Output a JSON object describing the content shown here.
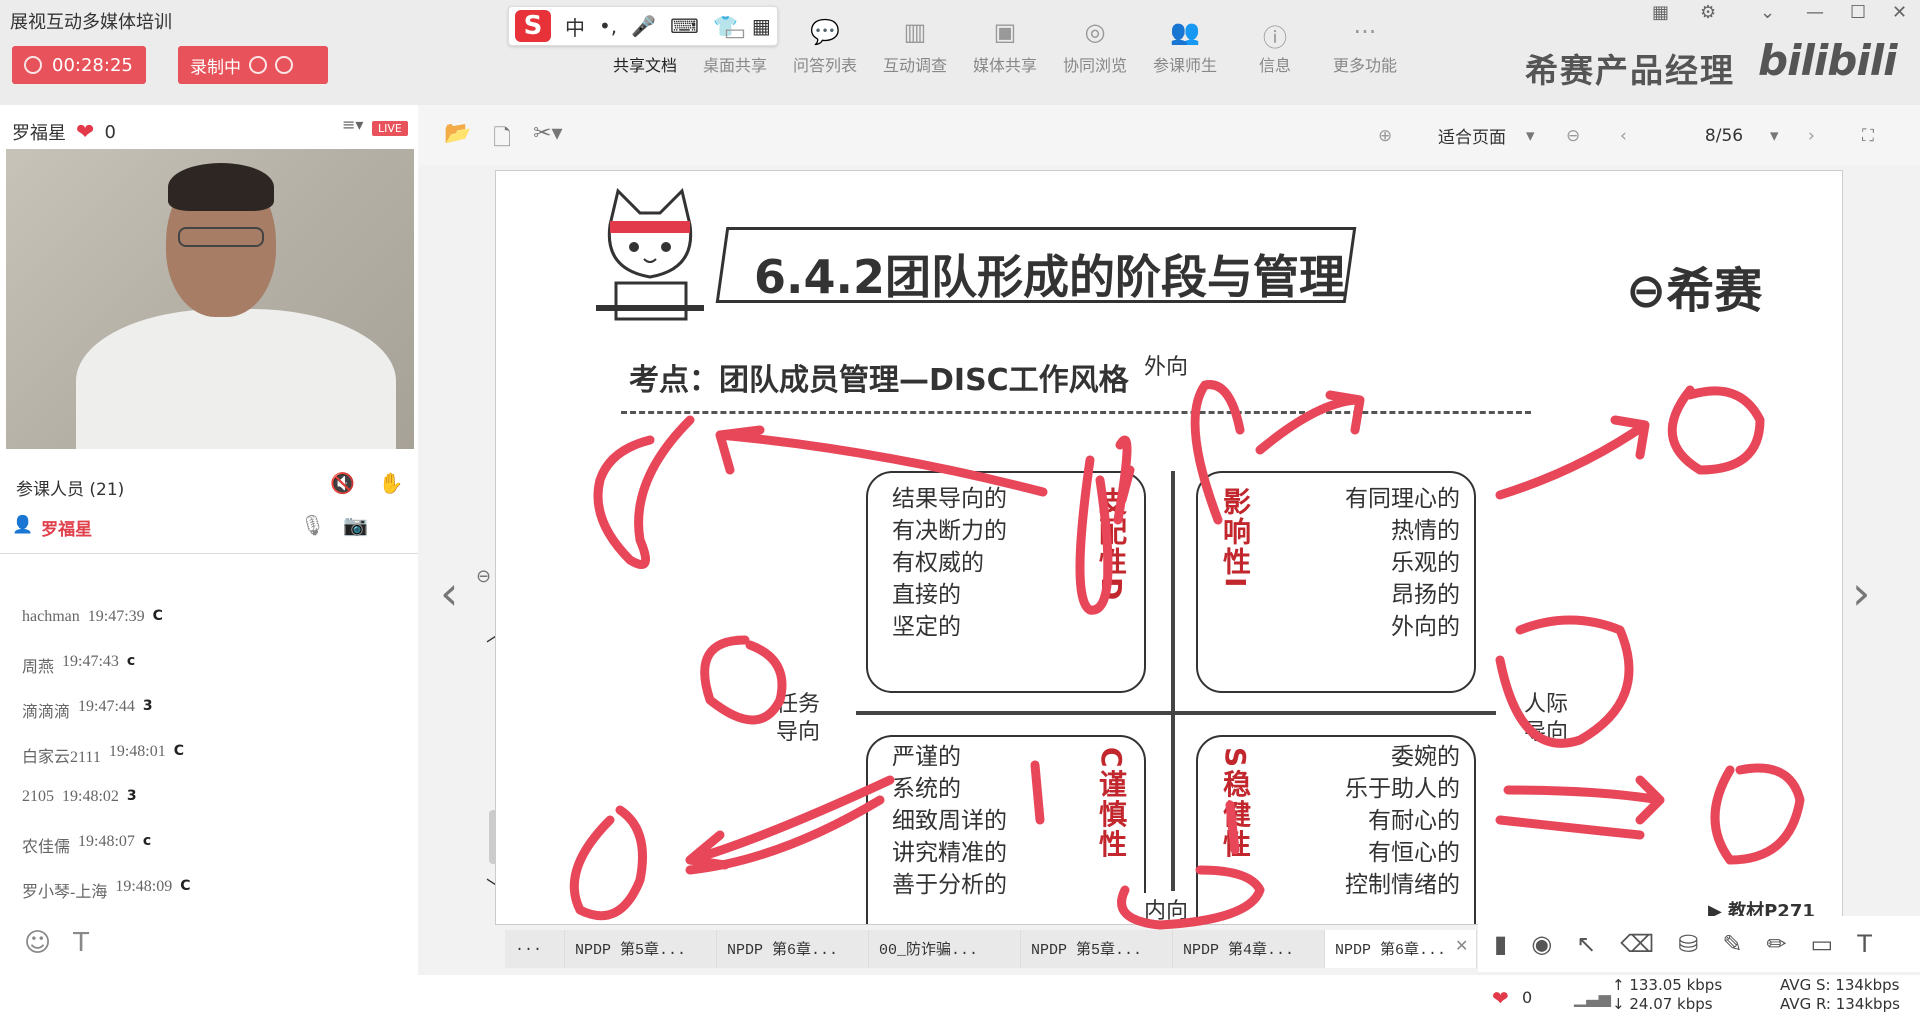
{
  "app": {
    "title": "展视互动多媒体培训"
  },
  "recording": {
    "elapsed": "00:28:25",
    "status": "录制中"
  },
  "ime": {
    "mode": "中",
    "punct": "•,"
  },
  "toolbar": {
    "tools": [
      {
        "label": "共享文档",
        "icon": "document-share-icon"
      },
      {
        "label": "桌面共享",
        "icon": "desktop-share-icon"
      },
      {
        "label": "问答列表",
        "icon": "qa-list-icon"
      },
      {
        "label": "互动调查",
        "icon": "survey-icon"
      },
      {
        "label": "媒体共享",
        "icon": "media-share-icon"
      },
      {
        "label": "协同浏览",
        "icon": "co-browse-icon"
      },
      {
        "label": "参课师生",
        "icon": "participants-icon"
      },
      {
        "label": "信息",
        "icon": "info-icon"
      },
      {
        "label": "更多功能",
        "icon": "more-icon"
      }
    ]
  },
  "brand": {
    "text": "希赛产品经理",
    "bilibili": "bilibili"
  },
  "host": {
    "name": "罗福星",
    "likes": "0",
    "live": "LIVE"
  },
  "attendees": {
    "label": "参课人员 (21)",
    "me": "罗福星"
  },
  "chat": {
    "messages": [
      {
        "user": "hachman",
        "time": "19:47:39",
        "text": "C"
      },
      {
        "user": "周燕",
        "time": "19:47:43",
        "text": "c"
      },
      {
        "user": "滴滴滴",
        "time": "19:47:44",
        "text": "3"
      },
      {
        "user": "白家云2111",
        "time": "19:48:01",
        "text": "C"
      },
      {
        "user": "2105",
        "time": "19:48:02",
        "text": "3"
      },
      {
        "user": "农佳儒",
        "time": "19:48:07",
        "text": "c"
      },
      {
        "user": "罗小琴-上海",
        "time": "19:48:09",
        "text": "C"
      }
    ]
  },
  "doc": {
    "zoom": "适合页面",
    "page": "8/56"
  },
  "slide": {
    "title": "6.4.2团队形成的阶段与管理",
    "logo": "希赛",
    "subtitle": "考点：团队成员管理—DISC工作风格",
    "axis": {
      "top": "外向",
      "bottom": "内向",
      "left": "任务\n导向",
      "right": "人际\n导向"
    },
    "quadrants": {
      "d": {
        "traits": [
          "结果导向的",
          "有决断力的",
          "有权威的",
          "直接的",
          "坚定的"
        ],
        "name": "支配性D"
      },
      "i": {
        "traits": [
          "有同理心的",
          "热情的",
          "乐观的",
          "昂扬的",
          "外向的"
        ],
        "name": "影响性I"
      },
      "c": {
        "traits": [
          "严谨的",
          "系统的",
          "细致周详的",
          "讲究精准的",
          "善于分析的"
        ],
        "name": "C谨慎性"
      },
      "s": {
        "traits": [
          "委婉的",
          "乐于助人的",
          "有耐心的",
          "有恒心的",
          "控制情绪的"
        ],
        "name": "S稳健性"
      }
    },
    "reference": "▶ 教材P271"
  },
  "tabs": [
    {
      "label": "..."
    },
    {
      "label": "NPDP 第5章..."
    },
    {
      "label": "NPDP 第6章..."
    },
    {
      "label": "00_防诈骗..."
    },
    {
      "label": "NPDP 第5章..."
    },
    {
      "label": "NPDP 第4章..."
    },
    {
      "label": "NPDP 第6章..."
    }
  ],
  "status": {
    "likes": "0",
    "send_rate": "↑ 133.05 kbps",
    "recv_rate": "↓ 24.07 kbps",
    "avg_s": "AVG S: 134kbps",
    "avg_r": "AVG R: 134kbps"
  },
  "colors": {
    "accent": "#e8525a",
    "annotation": "#e8475a",
    "quadrant_letter": "#c2272d"
  }
}
